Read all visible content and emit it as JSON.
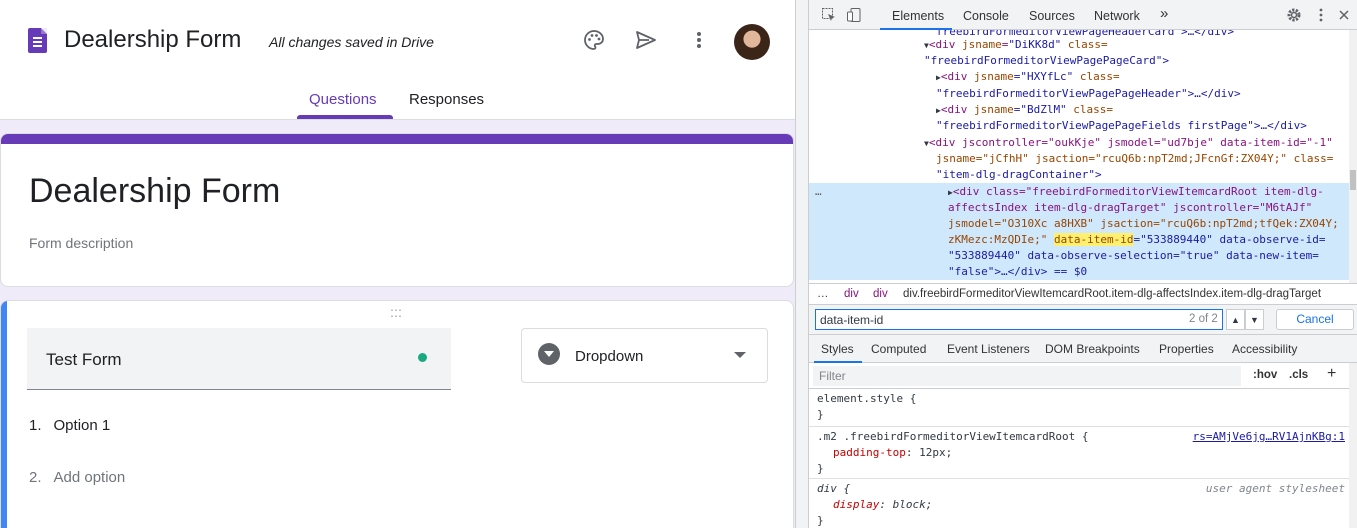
{
  "forms": {
    "app_title": "Dealership Form",
    "save_status": "All changes saved in Drive",
    "tabs": {
      "questions": "Questions",
      "responses": "Responses"
    },
    "header_icons": [
      "palette-icon",
      "send-icon",
      "more-vert-icon"
    ],
    "form_title": "Dealership Form",
    "form_description": "Form description",
    "question": {
      "title": "Test Form",
      "type": "Dropdown",
      "options": [
        {
          "num": "1.",
          "label": "Option 1"
        },
        {
          "num": "2.",
          "label": "Add option"
        }
      ]
    },
    "colors": {
      "accent": "#673ab7",
      "background": "#f0ebf8",
      "active_card": "#4285f4",
      "status_dot": "#1aa881"
    }
  },
  "devtools": {
    "tabs": [
      "Elements",
      "Console",
      "Sources",
      "Network"
    ],
    "more_tabs": "»",
    "dom": {
      "line0": "freebirdFormeditorViewPageHeaderCard\">…</div>",
      "line1_tag": "<div ",
      "line1_attr": "jsname",
      "line1_val": "\"DiKK8d\"",
      "line1_attr2": " class=",
      "line2": "\"freebirdFormeditorViewPagePageCard\">",
      "line3_a": "<div ",
      "line3_b": "jsname",
      "line3_c": "=\"HXYfLc\"",
      "line3_d": " class=",
      "line4": "\"freebirdFormeditorViewPagePageHeader\">…</div>",
      "line5_a": "<div ",
      "line5_b": "jsname",
      "line5_c": "=\"BdZlM\"",
      "line5_d": " class=",
      "line6": "\"freebirdFormeditorViewPagePageFields firstPage\">…</div>",
      "line7": "<div jscontroller=\"oukKje\" jsmodel=\"ud7bje\" data-item-id=\"-1\"",
      "line8": "jsname=\"jCfhH\" jsaction=\"rcuQ6b:npT2md;JFcnGf:ZX04Y;\" class=",
      "line9": "\"item-dlg-dragContainer\">",
      "sel1": "<div class=\"freebirdFormeditorViewItemcardRoot item-dlg-",
      "sel2": "affectsIndex item-dlg-dragTarget\" jscontroller=\"M6tAJf\"",
      "sel3": "jsmodel=\"O310Xc a8HXB\" jsaction=\"rcuQ6b:npT2md;tfQek:ZX04Y;",
      "sel4_pre": "zKMezc:MzQDIe;\" ",
      "sel4_hl": "data-item-id",
      "sel4_post": "=\"533889440\" data-observe-id=",
      "sel5": "\"533889440\" data-observe-selection=\"true\" data-new-item=",
      "sel6": "\"false\">…</div> == $0",
      "ellipsis": "…"
    },
    "breadcrumb": [
      "…",
      "div",
      "div",
      "div.freebirdFormeditorViewItemcardRoot.item-dlg-affectsIndex.item-dlg-dragTarget"
    ],
    "search": {
      "value": "data-item-id",
      "count": "2 of 2",
      "cancel": "Cancel"
    },
    "subtabs": [
      "Styles",
      "Computed",
      "Event Listeners",
      "DOM Breakpoints",
      "Properties",
      "Accessibility"
    ],
    "filter": {
      "placeholder": "Filter",
      "hov": ":hov",
      "cls": ".cls",
      "add": "+"
    },
    "rules": {
      "r1_sel": "element.style {",
      "r1_close": "}",
      "r2_sel": ".m2 .freebirdFormeditorViewItemcardRoot {",
      "r2_src": "rs=AMjVe6jg…RV1AjnKBg:1",
      "r2_prop": "padding-top",
      "r2_val": "12px;",
      "r2_close": "}",
      "r3_sel": "div {",
      "r3_src": "user agent stylesheet",
      "r3_prop": "display",
      "r3_val": "block;",
      "r3_close": "}"
    }
  }
}
